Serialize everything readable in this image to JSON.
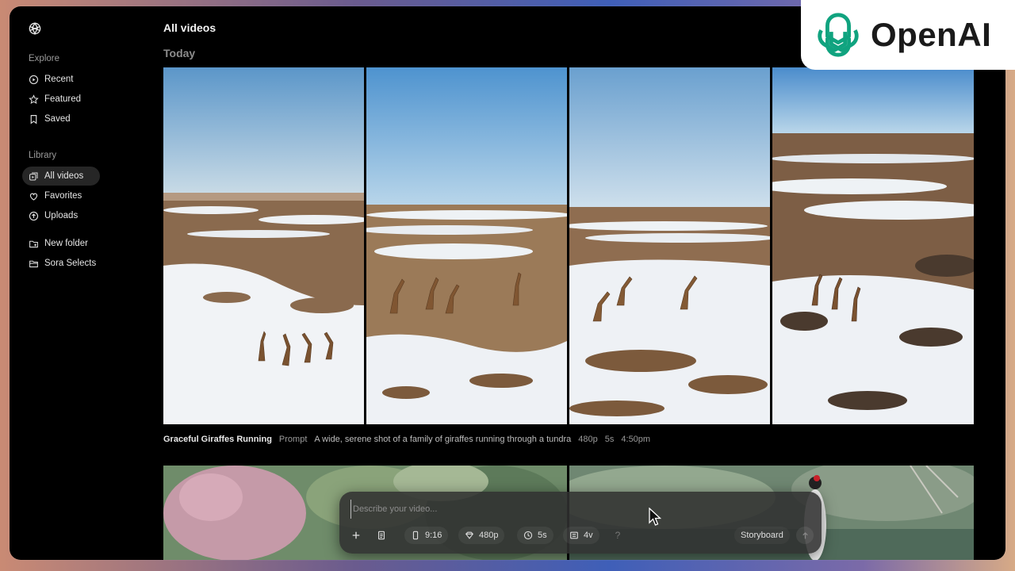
{
  "sidebar": {
    "explore_label": "Explore",
    "library_label": "Library",
    "explore_items": [
      {
        "label": "Recent",
        "icon": "play-circle-icon"
      },
      {
        "label": "Featured",
        "icon": "star-icon"
      },
      {
        "label": "Saved",
        "icon": "bookmark-icon"
      }
    ],
    "library_items": [
      {
        "label": "All videos",
        "icon": "videos-icon",
        "active": true
      },
      {
        "label": "Favorites",
        "icon": "heart-icon"
      },
      {
        "label": "Uploads",
        "icon": "upload-icon"
      }
    ],
    "folder_items": [
      {
        "label": "New folder",
        "icon": "folder-plus-icon"
      },
      {
        "label": "Sora Selects",
        "icon": "folder-icon"
      }
    ]
  },
  "main": {
    "title": "All videos",
    "section_date": "Today",
    "video": {
      "title": "Graceful Giraffes Running",
      "prompt_label": "Prompt",
      "prompt_text": "A wide, serene shot of a family of giraffes running through a tundra",
      "resolution": "480p",
      "duration": "5s",
      "time": "4:50pm"
    }
  },
  "composer": {
    "placeholder": "Describe your video...",
    "aspect_ratio": "9:16",
    "resolution": "480p",
    "duration": "5s",
    "variations": "4v",
    "help": "?",
    "storyboard_label": "Storyboard"
  },
  "badge": {
    "text": "OpenAI"
  },
  "colors": {
    "background": "#000000",
    "accent": "#10a37f"
  }
}
